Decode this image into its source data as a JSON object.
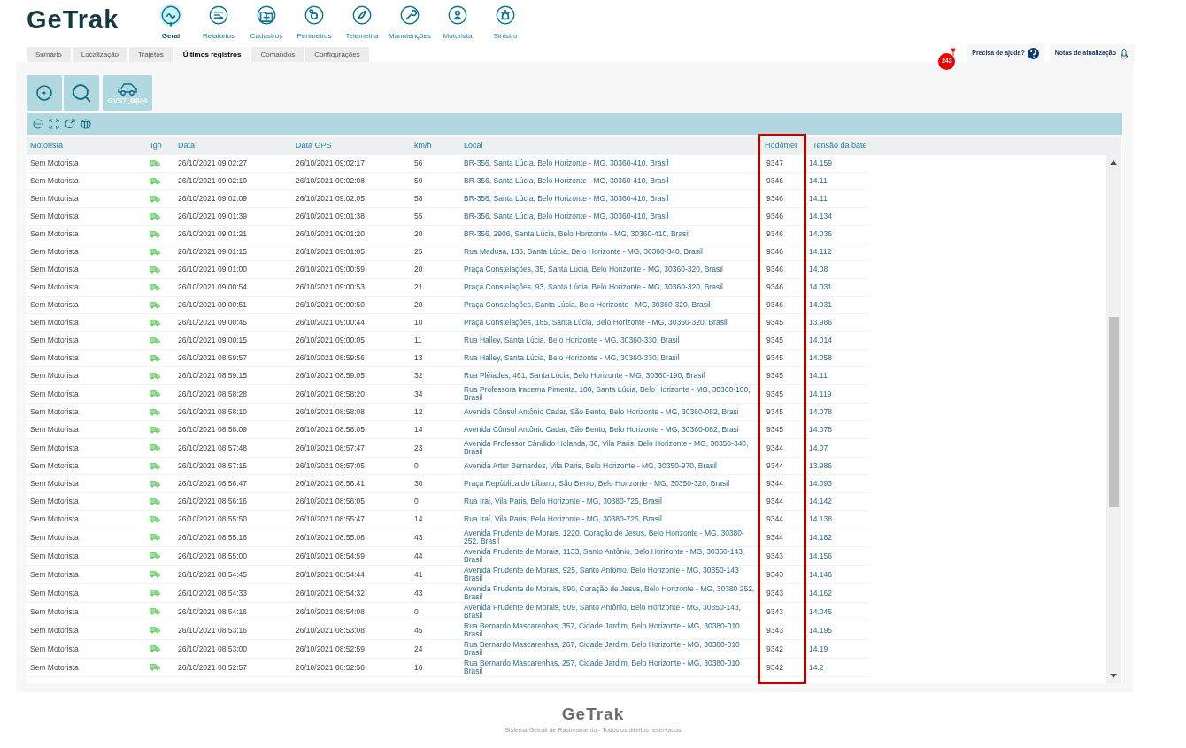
{
  "logo": "GeTrak",
  "nav": [
    {
      "label": "Geral",
      "selected": true
    },
    {
      "label": "Relatórios",
      "selected": false
    },
    {
      "label": "Cadastros",
      "selected": false
    },
    {
      "label": "Perímetros",
      "selected": false
    },
    {
      "label": "Telemetria",
      "selected": false
    },
    {
      "label": "Manutenções",
      "selected": false
    },
    {
      "label": "Motorista",
      "selected": false
    },
    {
      "label": "Sinistro",
      "selected": false
    }
  ],
  "tabs": [
    {
      "label": "Sumário",
      "selected": false
    },
    {
      "label": "Localização",
      "selected": false
    },
    {
      "label": "Trajetos",
      "selected": false
    },
    {
      "label": "Últimos registros",
      "selected": true
    },
    {
      "label": "Comandos",
      "selected": false
    },
    {
      "label": "Configurações",
      "selected": false
    }
  ],
  "notification_count": "243",
  "help_button": "Precisa de ajuda?",
  "notes_button": "Notas de atualização",
  "vehicle_plate": "GVS7_B824",
  "table": {
    "columns": [
      "Motorista",
      "Ign",
      "Data",
      "Data GPS",
      "km/h",
      "Local",
      "Hodômet",
      "Tensão da bate"
    ],
    "rows": [
      {
        "motorista": "Sem Motorista",
        "data": "26/10/2021 09:02:27",
        "data_gps": "26/10/2021 09:02:17",
        "kmh": "56",
        "local": "BR-356, Santa Lúcia, Belo Horizonte - MG, 30360-410, Brasil",
        "hodometro": "9347",
        "tensao": "14.159"
      },
      {
        "motorista": "Sem Motorista",
        "data": "26/10/2021 09:02:10",
        "data_gps": "26/10/2021 09:02:08",
        "kmh": "59",
        "local": "BR-356, Santa Lúcia, Belo Horizonte - MG, 30360-410, Brasil",
        "hodometro": "9346",
        "tensao": "14.11"
      },
      {
        "motorista": "Sem Motorista",
        "data": "26/10/2021 09:02:09",
        "data_gps": "26/10/2021 09:02:05",
        "kmh": "58",
        "local": "BR-356, Santa Lúcia, Belo Horizonte - MG, 30360-410, Brasil",
        "hodometro": "9346",
        "tensao": "14.11"
      },
      {
        "motorista": "Sem Motorista",
        "data": "26/10/2021 09:01:39",
        "data_gps": "26/10/2021 09:01:38",
        "kmh": "55",
        "local": "BR-356, Santa Lúcia, Belo Horizonte - MG, 30360-410, Brasil",
        "hodometro": "9346",
        "tensao": "14.134"
      },
      {
        "motorista": "Sem Motorista",
        "data": "26/10/2021 09:01:21",
        "data_gps": "26/10/2021 09:01:20",
        "kmh": "20",
        "local": "BR-356, 2906, Santa Lúcia, Belo Horizonte - MG, 30360-410, Brasil",
        "hodometro": "9346",
        "tensao": "14.036"
      },
      {
        "motorista": "Sem Motorista",
        "data": "26/10/2021 09:01:15",
        "data_gps": "26/10/2021 09:01:05",
        "kmh": "25",
        "local": "Rua Medusa, 135, Santa Lúcia, Belo Horizonte - MG, 30360-340, Brasil",
        "hodometro": "9346",
        "tensao": "14.112"
      },
      {
        "motorista": "Sem Motorista",
        "data": "26/10/2021 09:01:00",
        "data_gps": "26/10/2021 09:00:59",
        "kmh": "20",
        "local": "Praça Constelações, 35, Santa Lúcia, Belo Horizonte - MG, 30360-320, Brasil",
        "hodometro": "9346",
        "tensao": "14.08"
      },
      {
        "motorista": "Sem Motorista",
        "data": "26/10/2021 09:00:54",
        "data_gps": "26/10/2021 09:00:53",
        "kmh": "21",
        "local": "Praça Constelações, 93, Santa Lúcia, Belo Horizonte - MG, 30360-320, Brasil",
        "hodometro": "9346",
        "tensao": "14.031"
      },
      {
        "motorista": "Sem Motorista",
        "data": "26/10/2021 09:00:51",
        "data_gps": "26/10/2021 09:00:50",
        "kmh": "20",
        "local": "Praça Constelações, Santa Lúcia, Belo Horizonte - MG, 30360-320, Brasil",
        "hodometro": "9346",
        "tensao": "14.031"
      },
      {
        "motorista": "Sem Motorista",
        "data": "26/10/2021 09:00:45",
        "data_gps": "26/10/2021 09:00:44",
        "kmh": "10",
        "local": "Praça Constelações, 165, Santa Lúcia, Belo Horizonte - MG, 30360-320, Brasil",
        "hodometro": "9345",
        "tensao": "13.986"
      },
      {
        "motorista": "Sem Motorista",
        "data": "26/10/2021 09:00:15",
        "data_gps": "26/10/2021 09:00:05",
        "kmh": "11",
        "local": "Rua Halley, Santa Lúcia, Belo Horizonte - MG, 30360-330, Brasil",
        "hodometro": "9345",
        "tensao": "14.014"
      },
      {
        "motorista": "Sem Motorista",
        "data": "26/10/2021 08:59:57",
        "data_gps": "26/10/2021 08:59:56",
        "kmh": "13",
        "local": "Rua Halley, Santa Lúcia, Belo Horizonte - MG, 30360-330, Brasil",
        "hodometro": "9345",
        "tensao": "14.058"
      },
      {
        "motorista": "Sem Motorista",
        "data": "26/10/2021 08:59:15",
        "data_gps": "26/10/2021 08:59:05",
        "kmh": "32",
        "local": "Rua Plêiades, 461, Santa Lúcia, Belo Horizonte - MG, 30360-190, Brasil",
        "hodometro": "9345",
        "tensao": "14.11"
      },
      {
        "motorista": "Sem Motorista",
        "data": "26/10/2021 08:58:28",
        "data_gps": "26/10/2021 08:58:20",
        "kmh": "34",
        "local": "Rua Professora Iracema Pimenta, 100, Santa Lúcia, Belo Horizonte - MG, 30360-100, Brasil",
        "hodometro": "9345",
        "tensao": "14.119"
      },
      {
        "motorista": "Sem Motorista",
        "data": "26/10/2021 08:58:10",
        "data_gps": "26/10/2021 08:58:08",
        "kmh": "12",
        "local": "Avenida Cônsul Antônio Cadar, São Bento, Belo Horizonte - MG, 30360-082, Brasi",
        "hodometro": "9345",
        "tensao": "14.078"
      },
      {
        "motorista": "Sem Motorista",
        "data": "26/10/2021 08:58:09",
        "data_gps": "26/10/2021 08:58:05",
        "kmh": "14",
        "local": "Avenida Cônsul Antônio Cadar, São Bento, Belo Horizonte - MG, 30360-082, Brasi",
        "hodometro": "9345",
        "tensao": "14.078"
      },
      {
        "motorista": "Sem Motorista",
        "data": "26/10/2021 08:57:48",
        "data_gps": "26/10/2021 08:57:47",
        "kmh": "23",
        "local": "Avenida Professor Cândido Holanda, 30, Vila Paris, Belo Horizonte - MG, 30350-340, Brasil",
        "hodometro": "9344",
        "tensao": "14.07"
      },
      {
        "motorista": "Sem Motorista",
        "data": "26/10/2021 08:57:15",
        "data_gps": "26/10/2021 08:57:05",
        "kmh": "0",
        "local": "Avenida Artur Bernardes, Vila Paris, Belo Horizonte - MG, 30350-970, Brasil",
        "hodometro": "9344",
        "tensao": "13.986"
      },
      {
        "motorista": "Sem Motorista",
        "data": "26/10/2021 08:56:47",
        "data_gps": "26/10/2021 08:56:41",
        "kmh": "30",
        "local": "Praça República do Líbano, São Bento, Belo Horizonte - MG, 30350-320, Brasil",
        "hodometro": "9344",
        "tensao": "14.093"
      },
      {
        "motorista": "Sem Motorista",
        "data": "26/10/2021 08:56:16",
        "data_gps": "26/10/2021 08:56:05",
        "kmh": "0",
        "local": "Rua Iraí, Vila Paris, Belo Horizonte - MG, 30380-725, Brasil",
        "hodometro": "9344",
        "tensao": "14.142"
      },
      {
        "motorista": "Sem Motorista",
        "data": "26/10/2021 08:55:50",
        "data_gps": "26/10/2021 08:55:47",
        "kmh": "14",
        "local": "Rua Iraí, Vila Paris, Belo Horizonte - MG, 30380-725, Brasil",
        "hodometro": "9344",
        "tensao": "14.138"
      },
      {
        "motorista": "Sem Motorista",
        "data": "26/10/2021 08:55:16",
        "data_gps": "26/10/2021 08:55:08",
        "kmh": "43",
        "local": "Avenida Prudente de Morais, 1220, Coração de Jesus, Belo Horizonte - MG, 30380-252, Brasil",
        "hodometro": "9344",
        "tensao": "14.182"
      },
      {
        "motorista": "Sem Motorista",
        "data": "26/10/2021 08:55:00",
        "data_gps": "26/10/2021 08:54:59",
        "kmh": "44",
        "local": "Avenida Prudente de Morais, 1133, Santo Antônio, Belo Horizonte - MG, 30350-143, Brasil",
        "hodometro": "9343",
        "tensao": "14.156"
      },
      {
        "motorista": "Sem Motorista",
        "data": "26/10/2021 08:54:45",
        "data_gps": "26/10/2021 08:54:44",
        "kmh": "41",
        "local": "Avenida Prudente de Morais, 925, Santo Antônio, Belo Horizonte - MG, 30350-143 Brasil",
        "hodometro": "9343",
        "tensao": "14.146"
      },
      {
        "motorista": "Sem Motorista",
        "data": "26/10/2021 08:54:33",
        "data_gps": "26/10/2021 08:54:32",
        "kmh": "43",
        "local": "Avenida Prudente de Morais, 890, Coração de Jesus, Belo Horizonte - MG, 30380 252, Brasil",
        "hodometro": "9343",
        "tensao": "14.162"
      },
      {
        "motorista": "Sem Motorista",
        "data": "26/10/2021 08:54:16",
        "data_gps": "26/10/2021 08:54:08",
        "kmh": "0",
        "local": "Avenida Prudente de Morais, 509, Santo Antônio, Belo Horizonte - MG, 30350-143, Brasil",
        "hodometro": "9343",
        "tensao": "14.045"
      },
      {
        "motorista": "Sem Motorista",
        "data": "26/10/2021 08:53:16",
        "data_gps": "26/10/2021 08:53:08",
        "kmh": "45",
        "local": "Rua Bernardo Mascarenhas, 357, Cidade Jardim, Belo Horizonte - MG, 30380-010 Brasil",
        "hodometro": "9343",
        "tensao": "14.195"
      },
      {
        "motorista": "Sem Motorista",
        "data": "26/10/2021 08:53:00",
        "data_gps": "26/10/2021 08:52:59",
        "kmh": "24",
        "local": "Rua Bernardo Mascarenhas, 267, Cidade Jardim, Belo Horizonte - MG, 30380-010 Brasil",
        "hodometro": "9342",
        "tensao": "14.19"
      },
      {
        "motorista": "Sem Motorista",
        "data": "26/10/2021 08:52:57",
        "data_gps": "26/10/2021 08:52:56",
        "kmh": "16",
        "local": "Rua Bernardo Mascarenhas, 257, Cidade Jardim, Belo Horizonte - MG, 30380-010 Brasil",
        "hodometro": "9342",
        "tensao": "14.2"
      }
    ]
  },
  "footer": {
    "logo": "GeTrak",
    "text": "Sistema Getrak de Rastreamento - Todos os direitos reservados"
  }
}
